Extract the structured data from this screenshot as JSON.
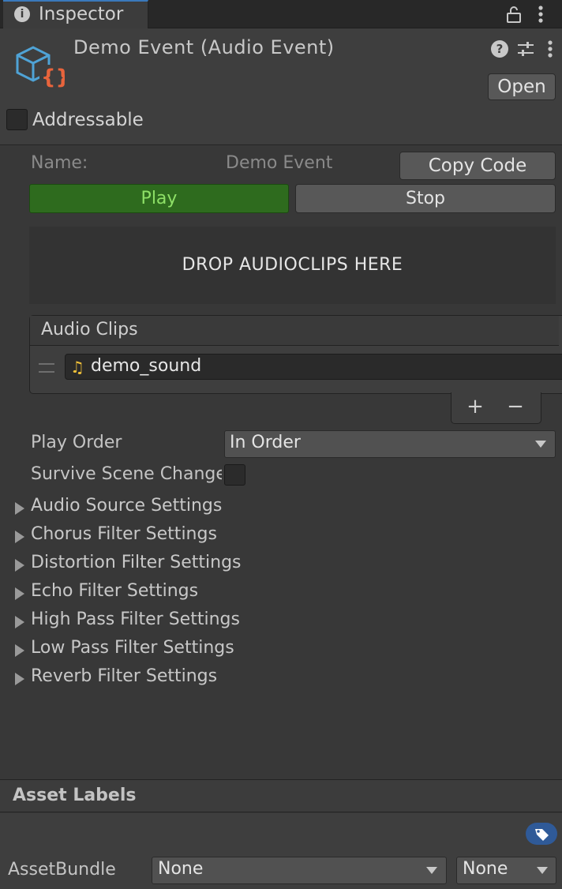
{
  "tab": {
    "label": "Inspector",
    "info_icon": "i"
  },
  "header": {
    "title": "Demo Event (Audio Event)",
    "help_icon": "?",
    "open_label": "Open",
    "addressable_label": "Addressable",
    "addressable_checked": false
  },
  "event": {
    "name_label": "Name:",
    "name_value": "Demo Event",
    "copy_code_label": "Copy Code",
    "play_label": "Play",
    "stop_label": "Stop",
    "drop_zone_text": "DROP AUDIOCLIPS HERE"
  },
  "clips": {
    "title": "Audio Clips",
    "items": [
      {
        "label": "demo_sound",
        "icon": "♫"
      }
    ],
    "add_label": "+",
    "remove_label": "−"
  },
  "fields": {
    "play_order_label": "Play Order",
    "play_order_value": "In Order",
    "survive_label": "Survive Scene Changes",
    "survive_checked": false
  },
  "foldouts": [
    "Audio Source Settings",
    "Chorus Filter Settings",
    "Distortion Filter Settings",
    "Echo Filter Settings",
    "High Pass Filter Settings",
    "Low Pass Filter Settings",
    "Reverb Filter Settings"
  ],
  "asset_labels": {
    "title": "Asset Labels",
    "bundle_label": "AssetBundle",
    "bundle_value": "None",
    "variant_value": "None"
  },
  "colors": {
    "accent": "#3a79bb",
    "play_green": "#2e6b1e",
    "icon_orange": "#e8643c",
    "icon_blue": "#4fa3d6",
    "tag_blue": "#2f5a98"
  }
}
